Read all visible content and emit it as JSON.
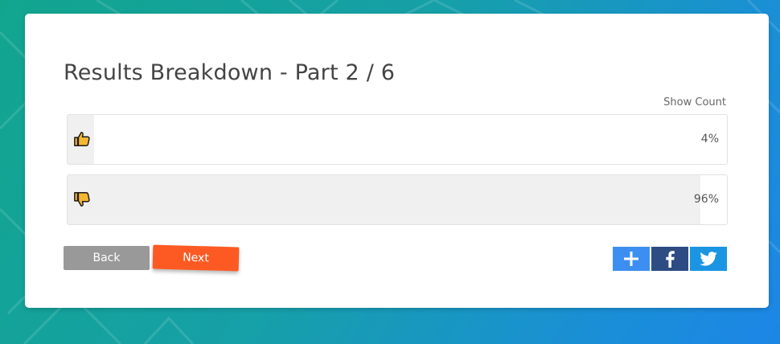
{
  "page": {
    "title": "Results Breakdown - Part 2 / 6",
    "show_count_label": "Show Count"
  },
  "results": [
    {
      "icon": "thumbs-up-icon",
      "percent_label": "4%",
      "fraction": 0.04
    },
    {
      "icon": "thumbs-down-icon",
      "percent_label": "96%",
      "fraction": 0.96
    }
  ],
  "buttons": {
    "back": "Back",
    "next": "Next"
  },
  "social": {
    "icons": [
      "plus-icon",
      "facebook-icon",
      "twitter-icon"
    ]
  },
  "colors": {
    "next_button": "#fd5a23",
    "back_button": "#999999",
    "icon_fill": "#f5b731",
    "plus_button": "#3c8ff0",
    "facebook_button": "#2d4c84",
    "twitter_button": "#1b95e2"
  }
}
